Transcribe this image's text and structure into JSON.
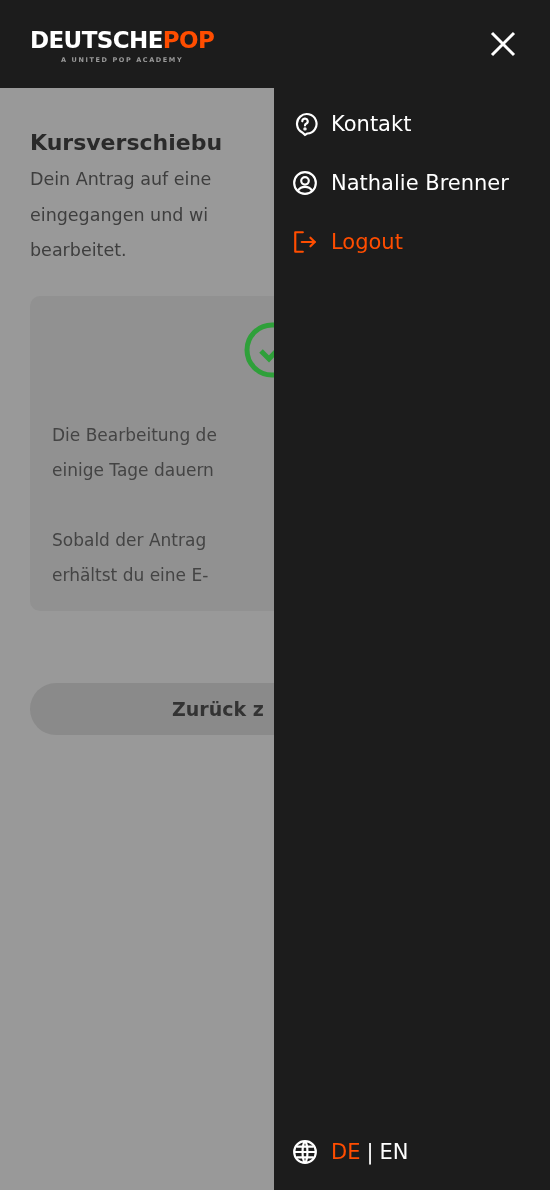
{
  "header": {
    "logo": {
      "primary": "DEUTSCHE",
      "accent": "POP",
      "tagline": "A UNITED POP ACADEMY"
    }
  },
  "background_page": {
    "title": "Kursverschiebu",
    "intro_lines": [
      "Dein Antrag auf eine",
      "eingegangen und wi",
      "bearbeitet."
    ],
    "card": {
      "paragraphs": [
        [
          "Die Bearbeitung de",
          "einige Tage dauern"
        ],
        [
          "Sobald der Antrag",
          "erhältst du eine E-"
        ]
      ]
    },
    "button": "Zurück z"
  },
  "menu": {
    "items": [
      {
        "kind": "help",
        "label": "Kontakt"
      },
      {
        "kind": "profile",
        "label": "Nathalie Brenner"
      },
      {
        "kind": "logout",
        "label": "Logout"
      }
    ],
    "languages": [
      {
        "label": "DE",
        "selected": true
      },
      {
        "label": "EN",
        "selected": false
      }
    ],
    "separator": "|"
  }
}
